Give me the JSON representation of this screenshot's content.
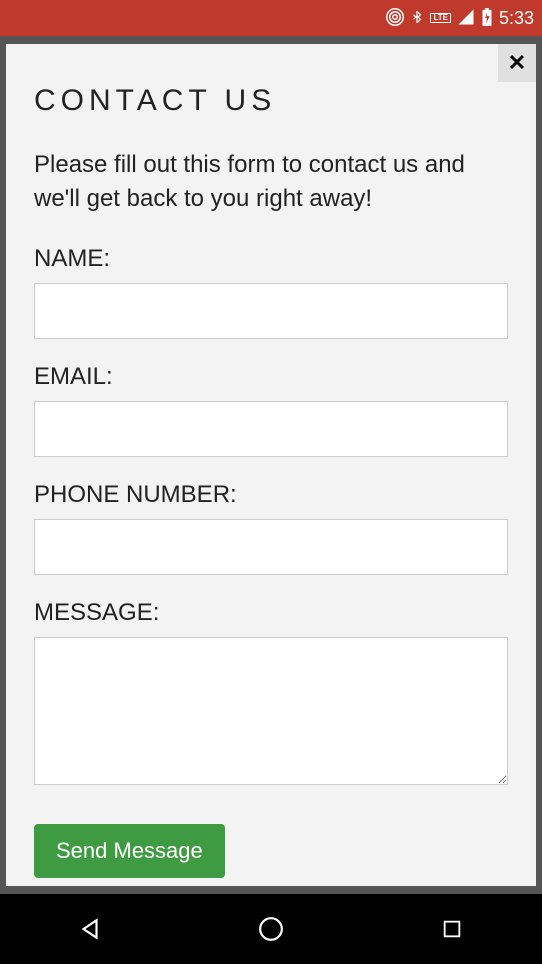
{
  "status_bar": {
    "time": "5:33"
  },
  "modal": {
    "title": "CONTACT US",
    "description": "Please fill out this form to contact us and we'll get back to you right away!",
    "fields": {
      "name": {
        "label": "NAME:",
        "value": ""
      },
      "email": {
        "label": "EMAIL:",
        "value": ""
      },
      "phone": {
        "label": "PHONE NUMBER:",
        "value": ""
      },
      "message": {
        "label": "MESSAGE:",
        "value": ""
      }
    },
    "submit_label": "Send Message"
  }
}
